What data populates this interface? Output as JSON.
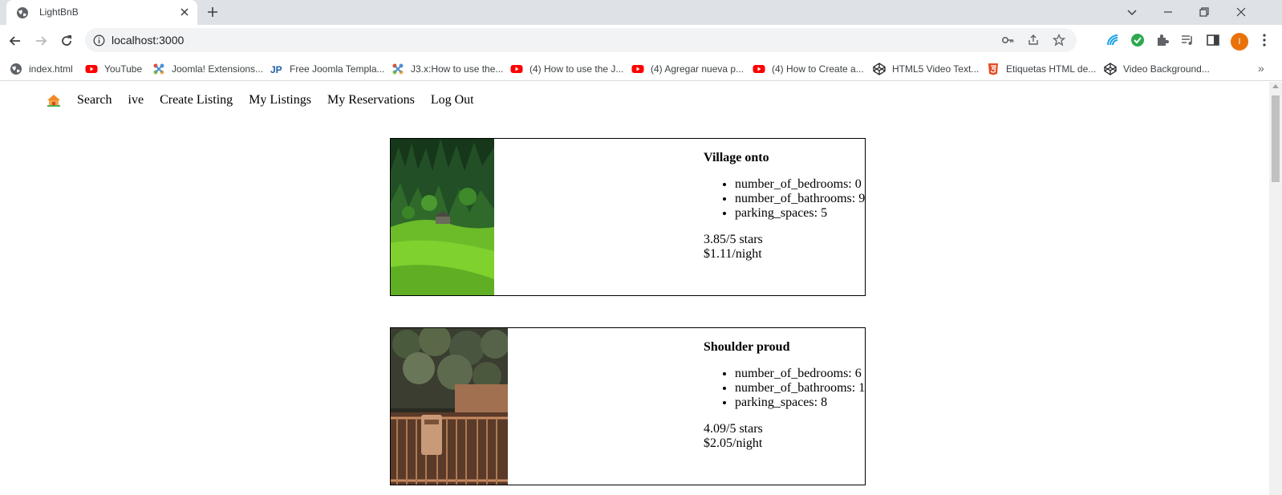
{
  "browser": {
    "tab": {
      "title": "LightBnB"
    },
    "url": "localhost:3000",
    "profile_initial": "I",
    "bookmarks": [
      {
        "label": "index.html",
        "icon": "globe-icon"
      },
      {
        "label": "YouTube",
        "icon": "youtube-icon"
      },
      {
        "label": "Joomla! Extensions...",
        "icon": "joomla-icon"
      },
      {
        "label": "Free Joomla Templa...",
        "icon": "jp-icon"
      },
      {
        "label": "J3.x:How to use the...",
        "icon": "joomla-icon"
      },
      {
        "label": "(4) How to use the J...",
        "icon": "youtube-icon"
      },
      {
        "label": "(4) Agregar nueva p...",
        "icon": "youtube-icon"
      },
      {
        "label": "(4) How to Create a...",
        "icon": "youtube-icon"
      },
      {
        "label": "HTML5 Video Text...",
        "icon": "codepen-icon"
      },
      {
        "label": "Etiquetas HTML de...",
        "icon": "html5-icon"
      },
      {
        "label": "Video Background...",
        "icon": "codepen-icon"
      }
    ],
    "bm_more": "»"
  },
  "site": {
    "nav": {
      "search": "Search",
      "user": "ive",
      "create_listing": "Create Listing",
      "my_listings": "My Listings",
      "my_reservations": "My Reservations",
      "logout": "Log Out"
    },
    "listings": [
      {
        "title": "Village onto",
        "features": [
          "number_of_bedrooms: 0",
          "number_of_bathrooms: 9",
          "parking_spaces: 5"
        ],
        "rating": "3.85/5 stars",
        "price": "$1.11/night"
      },
      {
        "title": "Shoulder proud",
        "features": [
          "number_of_bedrooms: 6",
          "number_of_bathrooms: 1",
          "parking_spaces: 8"
        ],
        "rating": "4.09/5 stars",
        "price": "$2.05/night"
      }
    ]
  },
  "colors": {
    "tabstrip": "#dee1e6",
    "profile": "#e8710a",
    "youtube": "#ff0000",
    "html5": "#e44d26"
  }
}
